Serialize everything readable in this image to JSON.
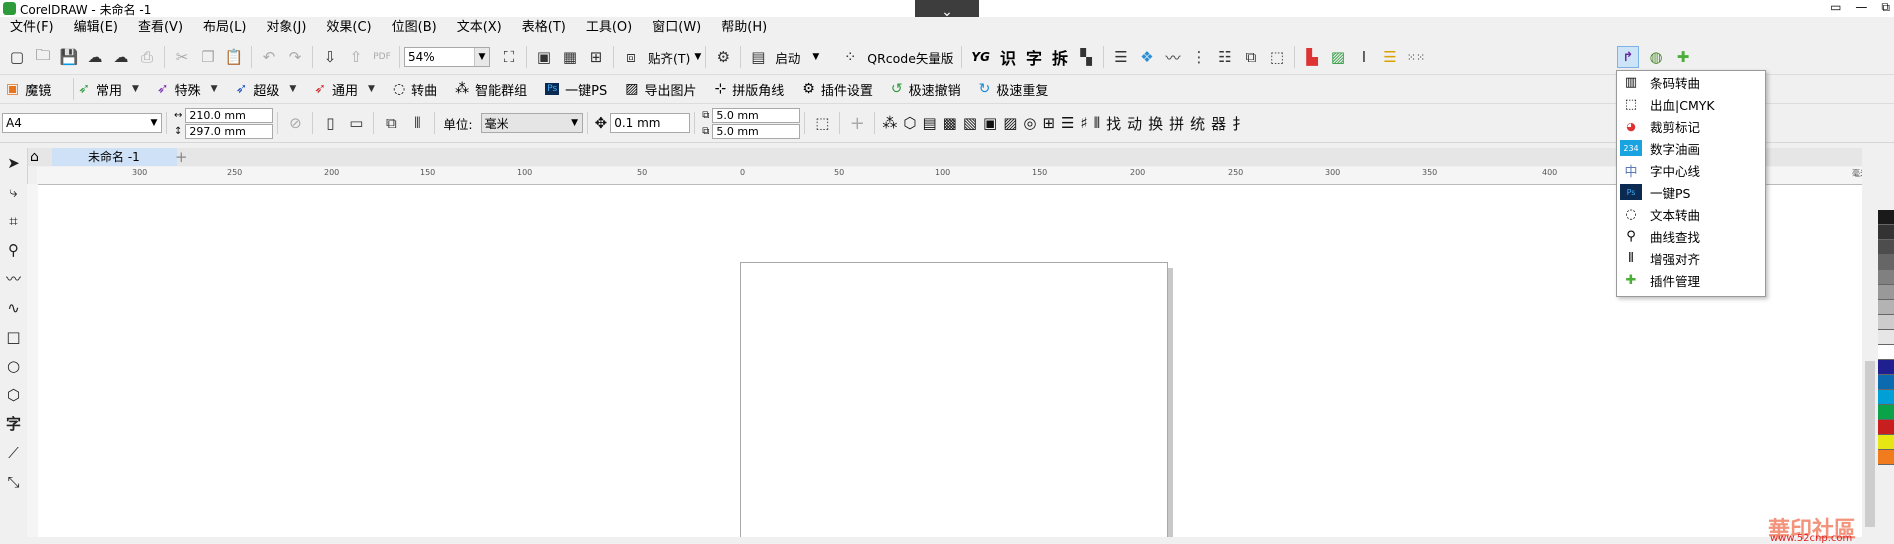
{
  "window": {
    "title": "CorelDRAW - 未命名 -1",
    "collapse_glyph": "⌄",
    "controls": [
      "▭",
      "—",
      "⧉"
    ]
  },
  "menu": [
    "文件(F)",
    "编辑(E)",
    "查看(V)",
    "布局(L)",
    "对象(J)",
    "效果(C)",
    "位图(B)",
    "文本(X)",
    "表格(T)",
    "工具(O)",
    "窗口(W)",
    "帮助(H)"
  ],
  "toolbar1": {
    "zoom": "54%",
    "snap_label": "贴齐(T)",
    "launch_label": "启动",
    "qrcode_label": "QRcode矢量版",
    "yg_glyph": "YG",
    "glyph_buttons": [
      "识",
      "字",
      "拆"
    ]
  },
  "toolbar2": {
    "items": [
      {
        "icon": "magic-mirror-icon",
        "label": "魔镜",
        "dropdown": false
      },
      {
        "icon": "green-arrow-icon",
        "label": "常用",
        "dropdown": true
      },
      {
        "icon": "purple-arrow-icon",
        "label": "特殊",
        "dropdown": true
      },
      {
        "icon": "blue-arrow-icon",
        "label": "超级",
        "dropdown": true
      },
      {
        "icon": "red-arrow-icon",
        "label": "通用",
        "dropdown": true
      },
      {
        "icon": "convert-curve-icon",
        "label": "转曲",
        "dropdown": false
      },
      {
        "icon": "smart-group-icon",
        "label": "智能群组",
        "dropdown": false
      },
      {
        "icon": "ps-icon",
        "label": "一键PS",
        "dropdown": false
      },
      {
        "icon": "export-image-icon",
        "label": "导出图片",
        "dropdown": false
      },
      {
        "icon": "crop-marks-icon",
        "label": "拼版角线",
        "dropdown": false
      },
      {
        "icon": "gear-icon",
        "label": "插件设置",
        "dropdown": false
      },
      {
        "icon": "undo-icon",
        "label": "极速撤销",
        "dropdown": false
      },
      {
        "icon": "redo-icon",
        "label": "极速重复",
        "dropdown": false
      }
    ]
  },
  "propbar": {
    "paper_size": "A4",
    "width": "210.0 mm",
    "height": "297.0 mm",
    "unit_label": "单位:",
    "unit": "毫米",
    "nudge": "0.1 mm",
    "dup_x": "5.0 mm",
    "dup_y": "5.0 mm",
    "text_buttons": [
      "找",
      "动",
      "换",
      "拼",
      "统",
      "器",
      "扌"
    ]
  },
  "tabs": {
    "doc_name": "未命名 -1"
  },
  "ruler": {
    "ticks": [
      "300",
      "250",
      "200",
      "150",
      "100",
      "50",
      "0",
      "50",
      "100",
      "150",
      "200",
      "250",
      "300",
      "350",
      "400"
    ],
    "unit": "毫米"
  },
  "popup": {
    "items": [
      {
        "icon": "barcode-icon",
        "label": "条码转曲"
      },
      {
        "icon": "bleed-icon",
        "label": "出血|CMYK"
      },
      {
        "icon": "crop-marks-color-icon",
        "label": "裁剪标记"
      },
      {
        "icon": "number-icon",
        "label": "数字油画"
      },
      {
        "icon": "center-line-icon",
        "label": "字中心线"
      },
      {
        "icon": "ps-icon",
        "label": "一键PS"
      },
      {
        "icon": "text-convert-icon",
        "label": "文本转曲"
      },
      {
        "icon": "curve-find-icon",
        "label": "曲线查找"
      },
      {
        "icon": "align-icon",
        "label": "增强对齐"
      },
      {
        "icon": "plugin-manage-icon",
        "label": "插件管理"
      }
    ]
  },
  "palette": [
    "#1a1a1a",
    "#333333",
    "#4d4d4d",
    "#666666",
    "#808080",
    "#999999",
    "#b3b3b3",
    "#cccccc",
    "#e6e6e6",
    "#ffffff",
    "#1f1f8f",
    "#0b6ab0",
    "#00a0d6",
    "#0aa34a",
    "#c81e1e",
    "#e6e614",
    "#f07c1e"
  ],
  "watermark": {
    "logo": "華印社區",
    "url": "www.52cnp.com"
  }
}
